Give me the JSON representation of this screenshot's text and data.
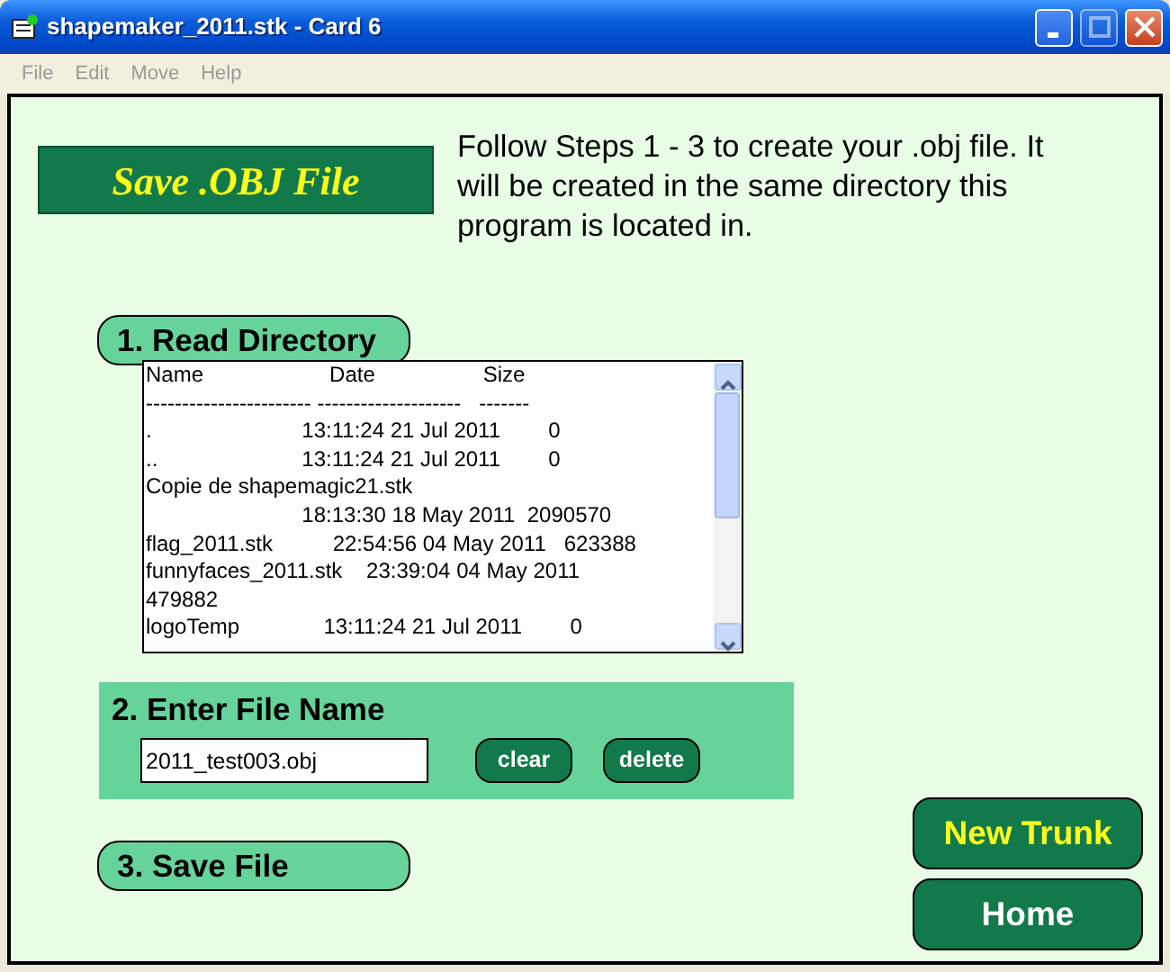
{
  "window": {
    "title": "shapemaker_2011.stk - Card 6",
    "controls": [
      {
        "kind": "minimize",
        "disabled": false
      },
      {
        "kind": "maximize",
        "disabled": true
      },
      {
        "kind": "close",
        "disabled": false
      }
    ]
  },
  "menu": [
    "File",
    "Edit",
    "Move",
    "Help"
  ],
  "heading": "Save .OBJ File",
  "instructions": "Follow Steps 1 - 3 to create your .obj file. It will be created in the same directory this program is located in.",
  "step1": {
    "label": "1. Read Directory"
  },
  "directory_listing": [
    "Name                     Date                  Size",
    "----------------------- --------------------   -------",
    ".                         13:11:24 21 Jul 2011        0",
    "..                        13:11:24 21 Jul 2011        0",
    "Copie de shapemagic21.stk",
    "                          18:13:30 18 May 2011  2090570",
    "flag_2011.stk          22:54:56 04 May 2011   623388",
    "funnyfaces_2011.stk    23:39:04 04 May 2011",
    "479882",
    "logoTemp              13:11:24 21 Jul 2011        0"
  ],
  "step2": {
    "label": "2. Enter File Name",
    "file_name": "2011_test003.obj",
    "buttons": [
      "clear",
      "delete"
    ]
  },
  "step3": {
    "label": "3. Save File"
  },
  "nav_buttons": [
    {
      "label": "New Trunk",
      "kind": "highlight"
    },
    {
      "label": "Home",
      "kind": "plain"
    }
  ]
}
